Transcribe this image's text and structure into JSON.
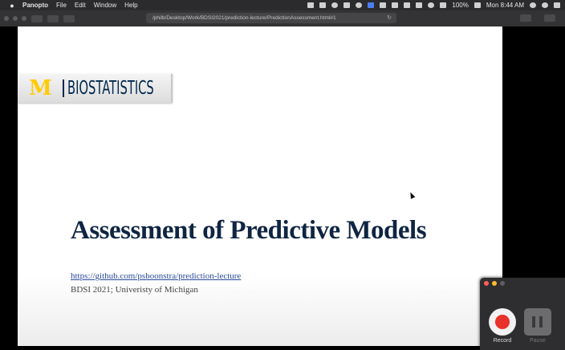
{
  "menubar": {
    "app_name": "Panopto",
    "menus": [
      "File",
      "Edit",
      "Window",
      "Help"
    ],
    "battery": "100%",
    "clock": "Mon 8:44 AM"
  },
  "browser": {
    "url": "/philb/Desktop/Work/BDSI2021/prediction-lecture/PredictionAssessment.html#1"
  },
  "slide": {
    "logo_letter": "M",
    "logo_text": "BIOSTATISTICS",
    "title": "Assessment of Predictive Models",
    "link": "https://github.com/psboonstra/prediction-lecture",
    "subtitle": "BDSI 2021; Univeristy of Michigan",
    "colors": {
      "maize": "#ffcb05",
      "blue": "#00274c"
    }
  },
  "recorder": {
    "record_label": "Record",
    "pause_label": "Pause"
  }
}
